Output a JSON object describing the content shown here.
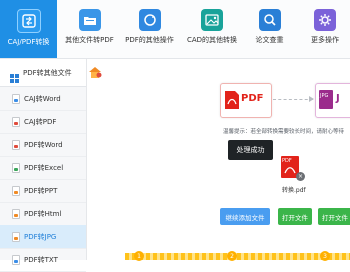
{
  "tabs": [
    {
      "label": "CAJ/PDF转换",
      "icon": "convert-icon",
      "active": true
    },
    {
      "label": "其他文件转PDF",
      "icon": "folder-icon",
      "active": false
    },
    {
      "label": "PDF的其他操作",
      "icon": "refresh-icon",
      "active": false
    },
    {
      "label": "CAD的其他转换",
      "icon": "image-icon",
      "active": false
    },
    {
      "label": "论文查重",
      "icon": "search-icon",
      "active": false
    },
    {
      "label": "更多操作",
      "icon": "gear-icon",
      "active": false
    }
  ],
  "sidebar": {
    "header": "PDF转其他文件",
    "items": [
      {
        "label": "CAJ转Word",
        "icon": "file-blue-icon"
      },
      {
        "label": "CAJ转PDF",
        "icon": "file-red-icon"
      },
      {
        "label": "PDF转Word",
        "icon": "file-red-icon"
      },
      {
        "label": "PDF转Excel",
        "icon": "file-green-icon"
      },
      {
        "label": "PDF转PPT",
        "icon": "file-orange-icon"
      },
      {
        "label": "PDF转Html",
        "icon": "file-orange-icon"
      },
      {
        "label": "PDF转JPG",
        "icon": "file-orange-icon",
        "active": true
      },
      {
        "label": "PDF转TXT",
        "icon": "file-blue-icon"
      }
    ]
  },
  "main": {
    "from_label": "PDF",
    "to_badge": "JPG",
    "to_label": "J",
    "tip": "温馨提示：若全部转换需要较长时间，请耐心等待",
    "toast": "处理成功",
    "file_name": "转换.pdf",
    "file_badge": "PDF",
    "buttons": {
      "add": "继续添加文件",
      "open_file": "打开文件",
      "open_folder": "打开文件"
    },
    "steps": [
      "1",
      "2",
      "3"
    ]
  },
  "colors": {
    "accent": "#1f8fe5",
    "pdf_red": "#e2231a",
    "jpg_purple": "#9b2b8c",
    "green": "#3bb54a"
  }
}
